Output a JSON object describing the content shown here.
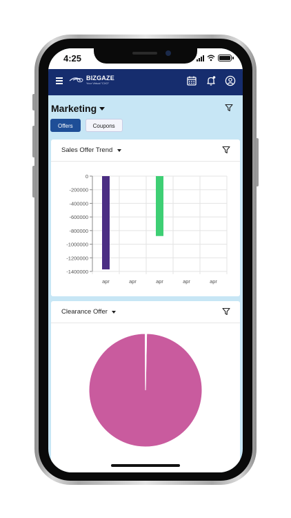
{
  "status_bar": {
    "time": "4:25"
  },
  "header": {
    "logo_name": "BIZGAZE",
    "logo_tagline": "Your Virtual \"CXO\"",
    "icons": [
      "menu-icon",
      "calendar-icon",
      "bell-icon",
      "user-icon"
    ],
    "bg_color": "#162d6e"
  },
  "page": {
    "title": "Marketing"
  },
  "tabs": [
    {
      "label": "Offers",
      "active": true
    },
    {
      "label": "Coupons",
      "active": false
    }
  ],
  "cards": {
    "sales_offer_trend": {
      "title": "Sales Offer Trend"
    },
    "clearance_offer": {
      "title": "Clearance Offer"
    }
  },
  "chart_data": [
    {
      "type": "bar",
      "title": "Sales Offer Trend",
      "categories": [
        "apr",
        "apr",
        "apr",
        "apr",
        "apr"
      ],
      "values": [
        -1370000,
        0,
        -880000,
        0,
        0
      ],
      "colors": [
        "#4b2e83",
        null,
        "#3ecf74",
        null,
        null
      ],
      "ylim": [
        -1400000,
        0
      ],
      "yticks": [
        0,
        -200000,
        -400000,
        -600000,
        -800000,
        -1000000,
        -1200000,
        -1400000
      ],
      "ytick_labels": [
        "0",
        "-200000",
        "-400000",
        "-600000",
        "-800000",
        "-1000000",
        "-1200000",
        "-1400000"
      ],
      "grid": true
    },
    {
      "type": "pie",
      "title": "Clearance Offer",
      "slices": [
        {
          "value": 99.6,
          "color": "#c95b9e"
        },
        {
          "value": 0.4,
          "color": "#ffffff"
        }
      ]
    }
  ]
}
